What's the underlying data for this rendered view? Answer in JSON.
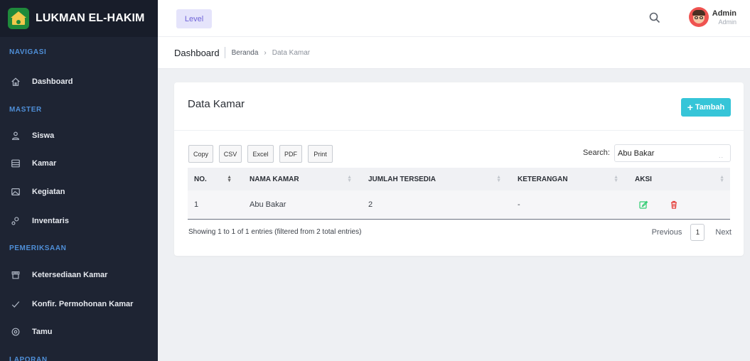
{
  "brand": {
    "name": "LUKMAN EL-HAKIM"
  },
  "sidebar": {
    "headings": [
      "NAVIGASI",
      "MASTER",
      "PEMERIKSAAN",
      "LAPORAN"
    ],
    "items": [
      {
        "label": "Dashboard",
        "icon": "home-icon"
      },
      {
        "label": "Siswa",
        "icon": "user-icon"
      },
      {
        "label": "Kamar",
        "icon": "room-icon"
      },
      {
        "label": "Kegiatan",
        "icon": "image-icon"
      },
      {
        "label": "Inventaris",
        "icon": "inventory-icon"
      },
      {
        "label": "Ketersediaan Kamar",
        "icon": "store-icon"
      },
      {
        "label": "Konfir. Permohonan Kamar",
        "icon": "check-icon"
      },
      {
        "label": "Tamu",
        "icon": "target-icon"
      }
    ]
  },
  "topbar": {
    "level_label": "Level",
    "user_name": "Admin",
    "user_role": "Admin"
  },
  "breadcrumb": {
    "title": "Dashboard",
    "home": "Beranda",
    "arrow": "›",
    "current": "Data Kamar"
  },
  "card": {
    "title": "Data Kamar",
    "add_label": "Tambah",
    "export_buttons": [
      "Copy",
      "CSV",
      "Excel",
      "PDF",
      "Print"
    ],
    "search_label": "Search:",
    "search_value": "Abu Bakar",
    "columns": [
      "NO.",
      "NAMA KAMAR",
      "JUMLAH TERSEDIA",
      "KETERANGAN",
      "AKSI"
    ],
    "rows": [
      {
        "no": "1",
        "nama": "Abu Bakar",
        "jumlah": "2",
        "keterangan": "-"
      }
    ],
    "info": "Showing 1 to 1 of 1 entries (filtered from 2 total entries)",
    "pager": {
      "prev": "Previous",
      "page": "1",
      "next": "Next"
    }
  },
  "colors": {
    "sidebar_bg": "#1e2433",
    "heading_blue": "#4f8fd8",
    "accent_cyan": "#36c5d8",
    "level_purple": "#6f63d8",
    "edit_green": "#2ecc71",
    "delete_red": "#e53935"
  }
}
